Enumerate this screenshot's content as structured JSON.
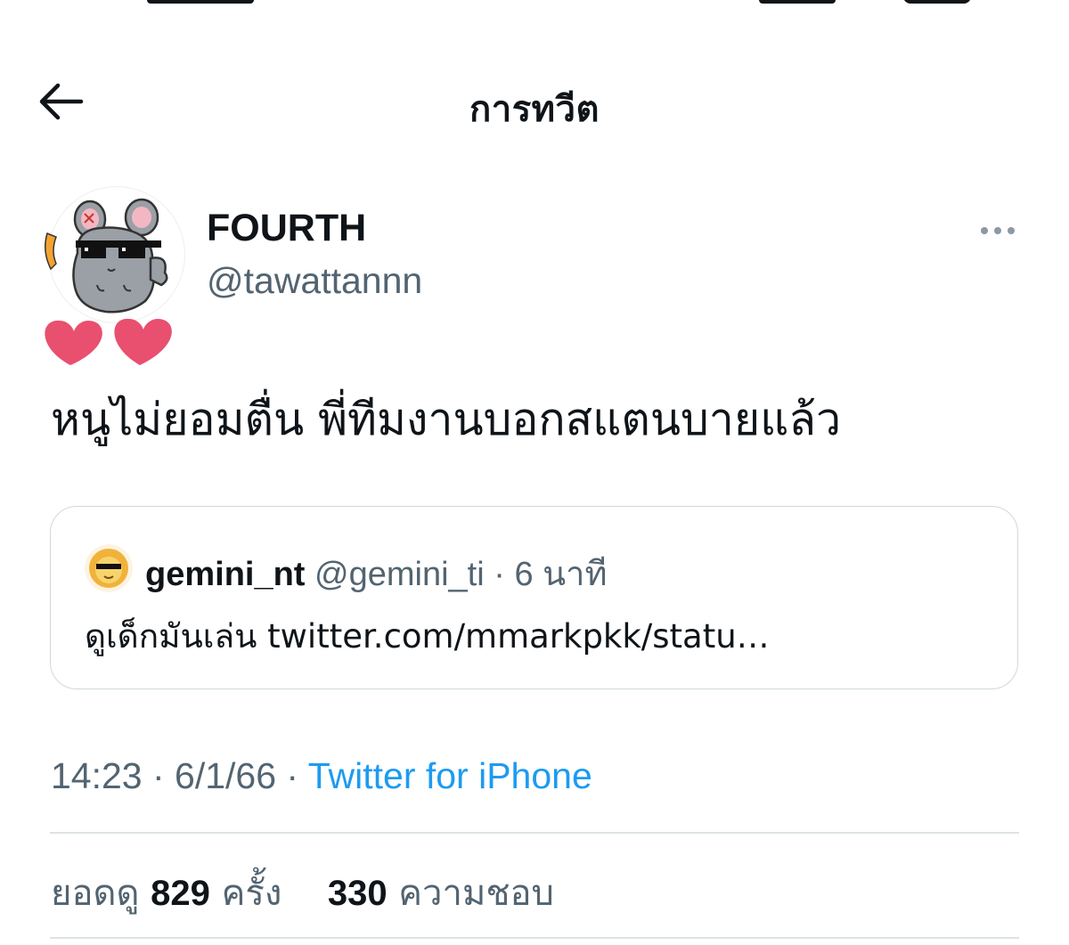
{
  "header": {
    "title": "การทวีต"
  },
  "tweet": {
    "author": {
      "display_name": "FOURTH",
      "handle": "@tawattannn"
    },
    "text": "หนูไม่ยอมตื่น พี่ทีมงานบอกสแตนบายแล้ว",
    "timestamp": "14:23 · 6/1/66 · ",
    "source": "Twitter for iPhone"
  },
  "quote": {
    "name": "gemini_nt",
    "meta": " @gemini_ti · 6 นาที",
    "text": "ดูเด็กมันเล่น twitter.com/mmarkpkk/statu…"
  },
  "stats": {
    "views_label": "ยอดดู",
    "views_count": "829",
    "views_unit": "ครั้ง",
    "likes_count": "330",
    "likes_label": "ความชอบ"
  },
  "icons": {
    "back": "arrow-left-icon",
    "more": "more-horizontal-icon"
  },
  "colors": {
    "accent": "#1d9bf0",
    "secondary_text": "#536471",
    "primary_text": "#0f1419",
    "border": "#cfd9de",
    "heart": "#e94f6e"
  }
}
